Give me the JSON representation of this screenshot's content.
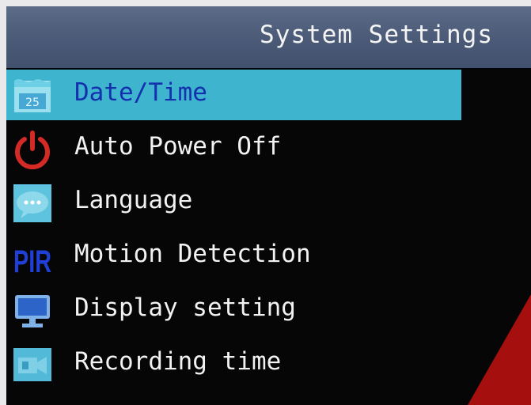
{
  "header": {
    "title": "System Settings"
  },
  "menu": {
    "items": [
      {
        "label": "Date/Time",
        "icon": "calendar-icon",
        "icon_text": "25",
        "selected": true
      },
      {
        "label": "Auto Power Off",
        "icon": "power-icon",
        "selected": false
      },
      {
        "label": "Language",
        "icon": "speech-bubble-icon",
        "selected": false
      },
      {
        "label": "Motion Detection",
        "icon": "pir-icon",
        "icon_text": "PIR",
        "selected": false
      },
      {
        "label": "Display setting",
        "icon": "monitor-icon",
        "selected": false
      },
      {
        "label": "Recording time",
        "icon": "video-camera-icon",
        "selected": false
      }
    ]
  },
  "colors": {
    "header_bg": "#4e5e7b",
    "screen_bg": "#060607",
    "selection_bg": "#3fb4cf",
    "selected_text": "#1330ad",
    "text": "#f2f2f2"
  }
}
